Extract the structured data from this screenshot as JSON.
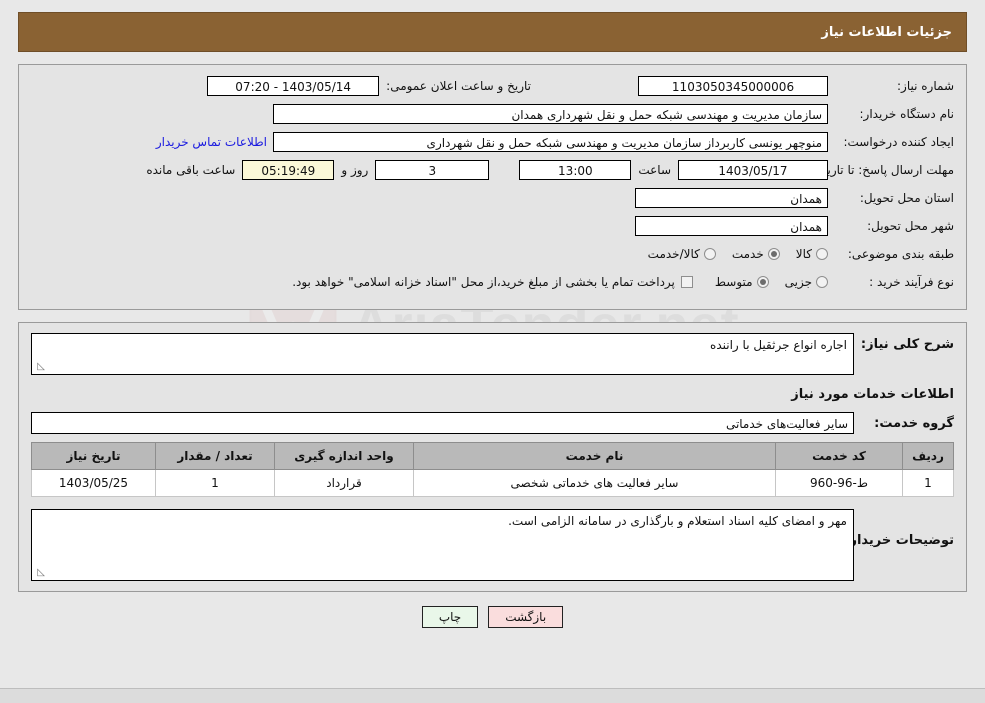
{
  "header": {
    "title": "جزئیات اطلاعات نیاز"
  },
  "colors": {
    "header_bar": "#8a6233",
    "link": "#1a1ae0",
    "countdown_bg": "#fbf8d8",
    "print_btn_bg": "#e9f7e9",
    "back_btn_bg": "#fadddd",
    "table_header_bg": "#b9b9b9"
  },
  "form": {
    "need_number_label": "شماره نیاز:",
    "need_number_value": "1103050345000006",
    "announce_datetime_label": "تاریخ و ساعت اعلان عمومی:",
    "announce_datetime_value": "1403/05/14 - 07:20",
    "buyer_org_label": "نام دستگاه خریدار:",
    "buyer_org_value": "سازمان مدیریت و مهندسی شبکه حمل و نقل شهرداری همدان",
    "requester_label": "ایجاد کننده درخواست:",
    "requester_value": "منوچهر یونسی کاربرداز سازمان مدیریت و مهندسی شبکه حمل و نقل شهرداری",
    "contact_link": "اطلاعات تماس خریدار",
    "deadline_label": "مهلت ارسال پاسخ: تا تاریخ:",
    "deadline_date": "1403/05/17",
    "deadline_hour_label": "ساعت",
    "deadline_hour": "13:00",
    "remaining_days": "3",
    "remaining_days_label": "روز و",
    "remaining_time": "05:19:49",
    "remaining_time_label": "ساعت باقی مانده",
    "province_label": "استان محل تحویل:",
    "province_value": "همدان",
    "city_label": "شهر محل تحویل:",
    "city_value": "همدان",
    "category_label": "طبقه بندی موضوعی:",
    "category_options": [
      {
        "label": "کالا",
        "checked": false
      },
      {
        "label": "خدمت",
        "checked": true
      },
      {
        "label": "کالا/خدمت",
        "checked": false
      }
    ],
    "process_label": "نوع فرآیند خرید :",
    "process_options": [
      {
        "label": "جزیی",
        "checked": false
      },
      {
        "label": "متوسط",
        "checked": true
      }
    ],
    "treasury_checkbox_checked": false,
    "treasury_note": "پرداخت تمام یا بخشی از مبلغ خرید،از محل \"اسناد خزانه اسلامی\" خواهد بود."
  },
  "middle": {
    "general_desc_label": "شرح کلی نیاز:",
    "general_desc_value": "اجاره انواع جرثقیل با راننده",
    "services_section_title": "اطلاعات خدمات مورد نیاز",
    "service_group_label": "گروه خدمت:",
    "service_group_value": "سایر فعالیت‌های خدماتی"
  },
  "table": {
    "headers": [
      "ردیف",
      "کد خدمت",
      "نام خدمت",
      "واحد اندازه گیری",
      "تعداد / مقدار",
      "تاریخ نیاز"
    ],
    "rows": [
      {
        "row_no": "1",
        "service_code": "ط-96-960",
        "service_name": "سایر فعالیت های خدماتی شخصی",
        "unit": "قرارداد",
        "quantity": "1",
        "need_date": "1403/05/25"
      }
    ]
  },
  "buyer_notes": {
    "label": "توضیحات خریدار:",
    "value": "مهر و امضای کلیه اسناد استعلام و بارگذاری در سامانه الزامی است."
  },
  "footer": {
    "print_label": "چاپ",
    "back_label": "بازگشت"
  },
  "watermark": {
    "text": "AriaTender.net"
  }
}
